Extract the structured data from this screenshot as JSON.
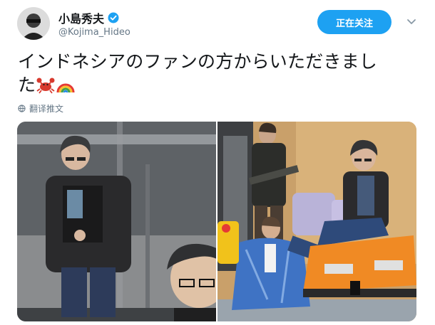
{
  "user": {
    "display_name": "小島秀夫",
    "handle": "@Kojima_Hideo",
    "avatar_icon": "user-avatar-icon",
    "verified_icon": "verified-badge-icon",
    "verified_color": "#1da1f2"
  },
  "actions": {
    "follow_label": "正在关注",
    "more_icon": "chevron-down-icon",
    "follow_color": "#1da1f2"
  },
  "tweet": {
    "text_line1": "インドネシアのファンの方からいただきまし",
    "text_line2": "た",
    "emojis": [
      "crab-emoji-icon",
      "rainbow-emoji-icon"
    ],
    "translate_label": "翻译推文",
    "translate_icon": "globe-icon"
  },
  "media": {
    "images": [
      "figure-photo-left",
      "figure-photo-right"
    ]
  }
}
